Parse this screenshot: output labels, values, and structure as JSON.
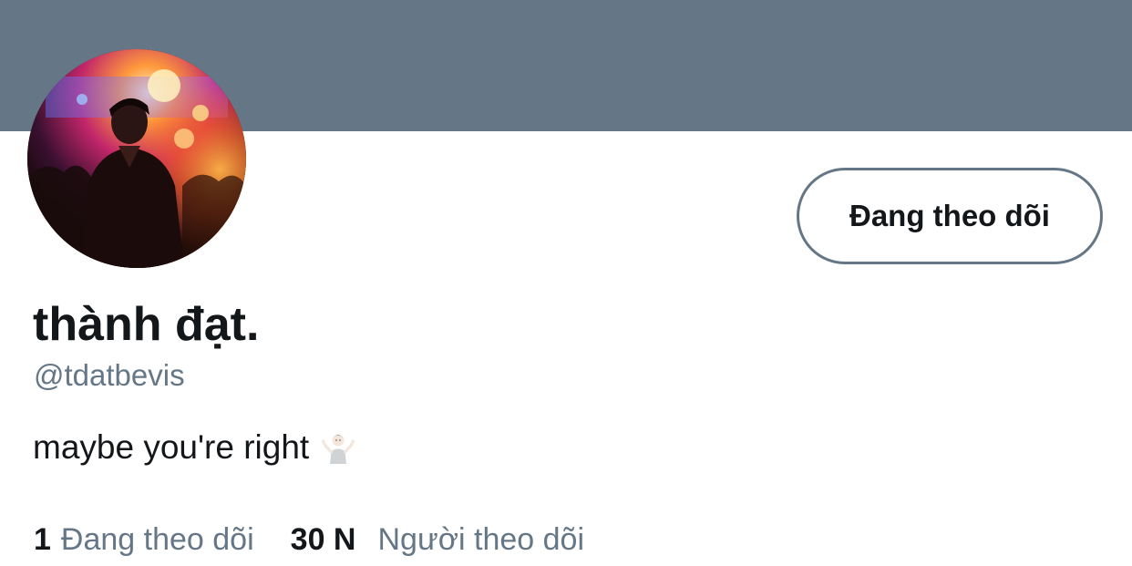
{
  "colors": {
    "banner": "#657786",
    "text_primary": "#14171a",
    "text_secondary": "#657786",
    "button_border": "#657786"
  },
  "profile": {
    "display_name": "thành đạt.",
    "handle": "@tdatbevis",
    "bio": "maybe you're right",
    "bio_emoji": "shrug-emoji-icon",
    "avatar": "profile-photo-concert"
  },
  "actions": {
    "follow_button_label": "Đang theo dõi"
  },
  "stats": {
    "following_count": "1",
    "following_label": "Đang theo dõi",
    "followers_count": "30 N",
    "followers_label": "Người theo dõi"
  }
}
